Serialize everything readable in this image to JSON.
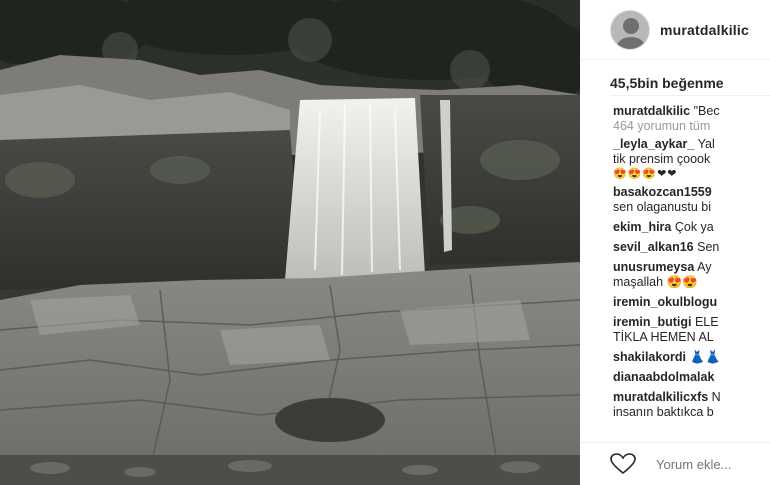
{
  "post": {
    "username": "muratdalkilic",
    "likes_text": "45,5bin beğenme",
    "caption_user": "muratdalkilic",
    "caption_text": "\"Bec",
    "view_comments": "464 yorumun tüm"
  },
  "comments": [
    {
      "user": "_leyla_aykar_",
      "text": "Yal",
      "line2": "tik prensim çoook",
      "line3": "😍😍😍❤❤"
    },
    {
      "user": "basakozcan1559",
      "text": "",
      "line2": "sen olaganustu bi"
    },
    {
      "user": "ekim_hira",
      "text": "Çok ya"
    },
    {
      "user": "sevil_alkan16",
      "text": "Sen"
    },
    {
      "user": "unusrumeysa",
      "text": "Ay",
      "line2": "maşallah 😍😍"
    },
    {
      "user": "iremin_okulblogu",
      "text": ""
    },
    {
      "user": "iremin_butigi",
      "text": "ELE",
      "line2": "TİKLA HEMEN AL"
    },
    {
      "user": "shakilakordi",
      "text": "👗👗"
    },
    {
      "user": "dianaabdolmalak",
      "text": ""
    },
    {
      "user": "muratdalkilicxfs",
      "text": "N",
      "line2": "insanın baktıkca b"
    }
  ],
  "footer": {
    "comment_placeholder": "Yorum ekle..."
  },
  "icons": {
    "like": "heart-outline-icon",
    "avatar": "user-avatar"
  }
}
